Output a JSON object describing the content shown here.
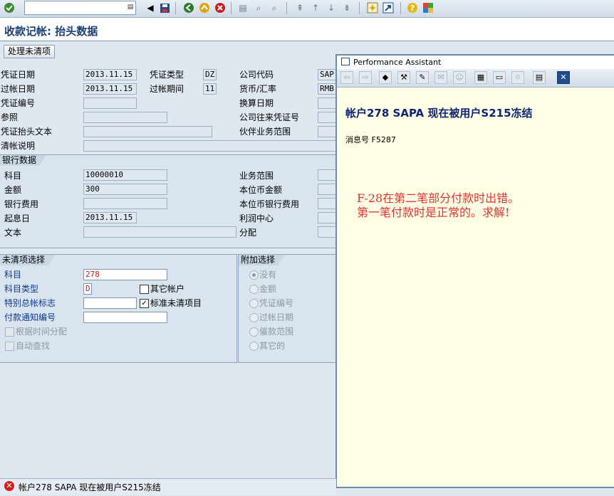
{
  "toolbar": {
    "command_value": ""
  },
  "title": "收款记帐: 抬头数据",
  "app_toolbar": {
    "process_open_items": "处理未清项"
  },
  "header": {
    "doc_date_label": "凭证日期",
    "doc_date": "2013.11.15",
    "doc_type_label": "凭证类型",
    "doc_type": "DZ",
    "company_code_label": "公司代码",
    "company_code": "SAP",
    "posting_date_label": "过帐日期",
    "posting_date": "2013.11.15",
    "period_label": "过帐期间",
    "period": "11",
    "currency_label": "货币/汇率",
    "currency": "RMB",
    "doc_no_label": "凭证编号",
    "doc_no": "",
    "translation_date_label": "换算日期",
    "reference_label": "参照",
    "reference": "",
    "cross_cc_label": "公司往来凭证号",
    "header_text_label": "凭证抬头文本",
    "header_text": "",
    "trading_partner_label": "伙伴业务范围",
    "clearing_text_label": "清帐说明",
    "clearing_text": ""
  },
  "bank": {
    "title": "银行数据",
    "account_label": "科目",
    "account": "10000010",
    "amount_label": "金额",
    "amount": "300",
    "bank_charges_label": "银行费用",
    "bank_charges": "",
    "value_date_label": "起息日",
    "value_date": "2013.11.15",
    "text_label": "文本",
    "text": "",
    "business_area_label": "业务范围",
    "lc_amount_label": "本位币金额",
    "lc_bank_charges_label": "本位币银行费用",
    "profit_center_label": "利润中心",
    "assignment_label": "分配"
  },
  "open_item_selection": {
    "title": "未清项选择",
    "account_label": "科目",
    "account": "278",
    "account_type_label": "科目类型",
    "account_type": "D",
    "other_accounts_label": "其它帐户",
    "special_gl_label": "特别总帐标志",
    "special_gl": "",
    "standard_oi_label": "标准未清项目",
    "payment_advice_label": "付款通知编号",
    "payment_advice": "",
    "distribute_by_age_label": "根据时间分配",
    "auto_search_label": "自动查找"
  },
  "additional_selection": {
    "title": "附加选择",
    "options": [
      "没有",
      "金额",
      "凭证编号",
      "过帐日期",
      "催款范围",
      "其它的"
    ],
    "selected": "没有"
  },
  "performance_assistant": {
    "window_title": "Performance Assistant",
    "heading": "帐户278 SAPA 现在被用户S215冻结",
    "message_no": "消息号 F5287",
    "annotation_line1": "F-28在第二笔部分付款时出错。",
    "annotation_line2": "第一笔付款时是正常的。求解!"
  },
  "status_bar": {
    "message": "帐户278 SAPA 现在被用户S215冻结"
  },
  "colors": {
    "title": "#1b3f73",
    "annotation": "#e03030",
    "error": "#d41c1c",
    "pa_heading": "#0d2476"
  }
}
